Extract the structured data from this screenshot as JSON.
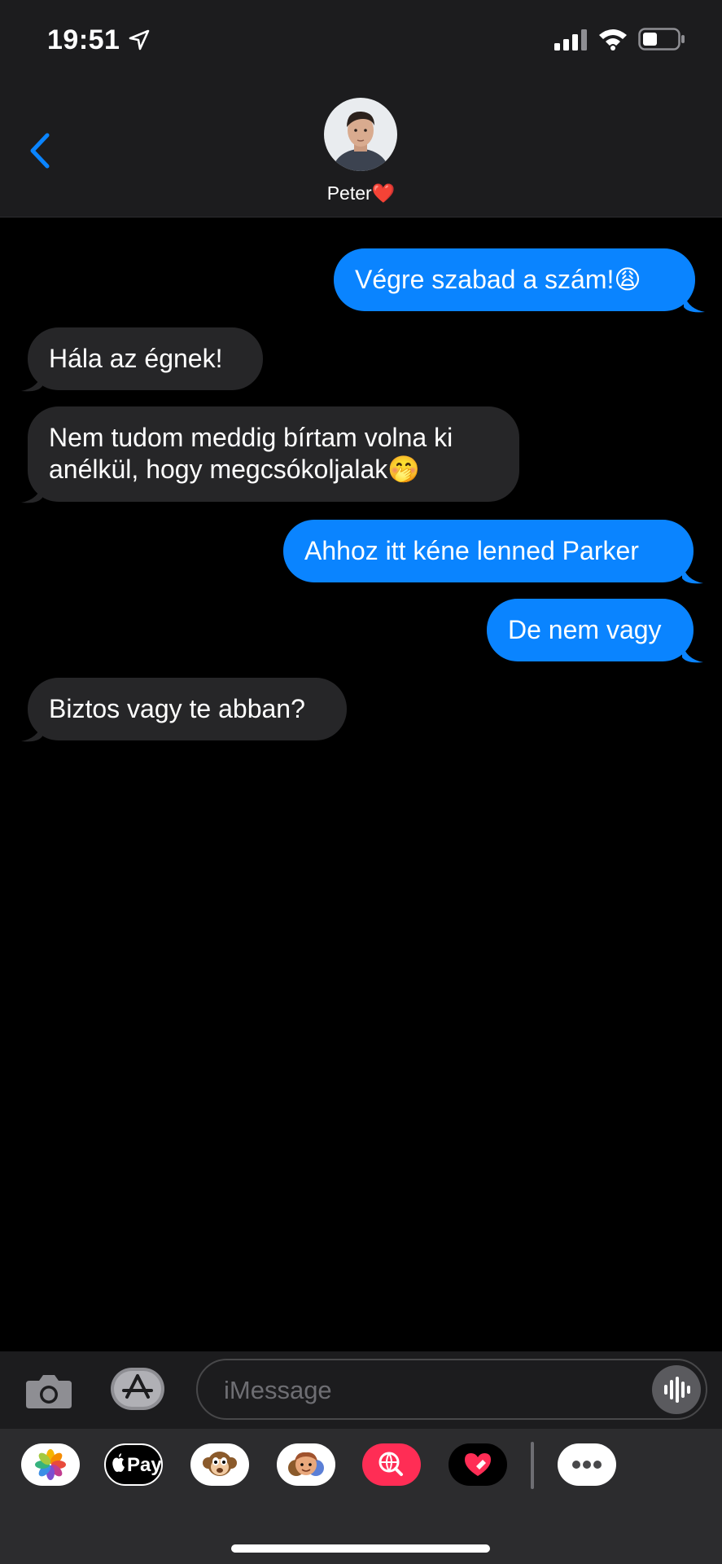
{
  "status_bar": {
    "time": "19:51"
  },
  "header": {
    "contact_name": "Peter",
    "contact_emoji": "❤️"
  },
  "messages": [
    {
      "direction": "outgoing",
      "lines": [
        "Végre szabad a szám!😩"
      ]
    },
    {
      "direction": "incoming",
      "lines": [
        "Hála az égnek!"
      ]
    },
    {
      "direction": "incoming",
      "lines": [
        "Nem tudom meddig bírtam volna ki",
        "anélkül, hogy megcsókoljalak🤭"
      ]
    },
    {
      "direction": "outgoing",
      "lines": [
        "Ahhoz itt kéne lenned Parker"
      ]
    },
    {
      "direction": "outgoing",
      "lines": [
        "De nem vagy"
      ]
    },
    {
      "direction": "incoming",
      "lines": [
        "Biztos vagy te abban?"
      ]
    }
  ],
  "composer": {
    "placeholder": "iMessage"
  },
  "app_drawer": {
    "items": [
      {
        "name": "photos-app-icon"
      },
      {
        "name": "apple-pay-icon",
        "label": "Pay"
      },
      {
        "name": "animoji-icon"
      },
      {
        "name": "memoji-icon"
      },
      {
        "name": "image-search-icon"
      },
      {
        "name": "digital-touch-icon"
      },
      {
        "name": "more-apps-icon"
      }
    ]
  },
  "colors": {
    "outgoing_bubble": "#0a84ff",
    "incoming_bubble": "#262628",
    "background": "#000000"
  }
}
